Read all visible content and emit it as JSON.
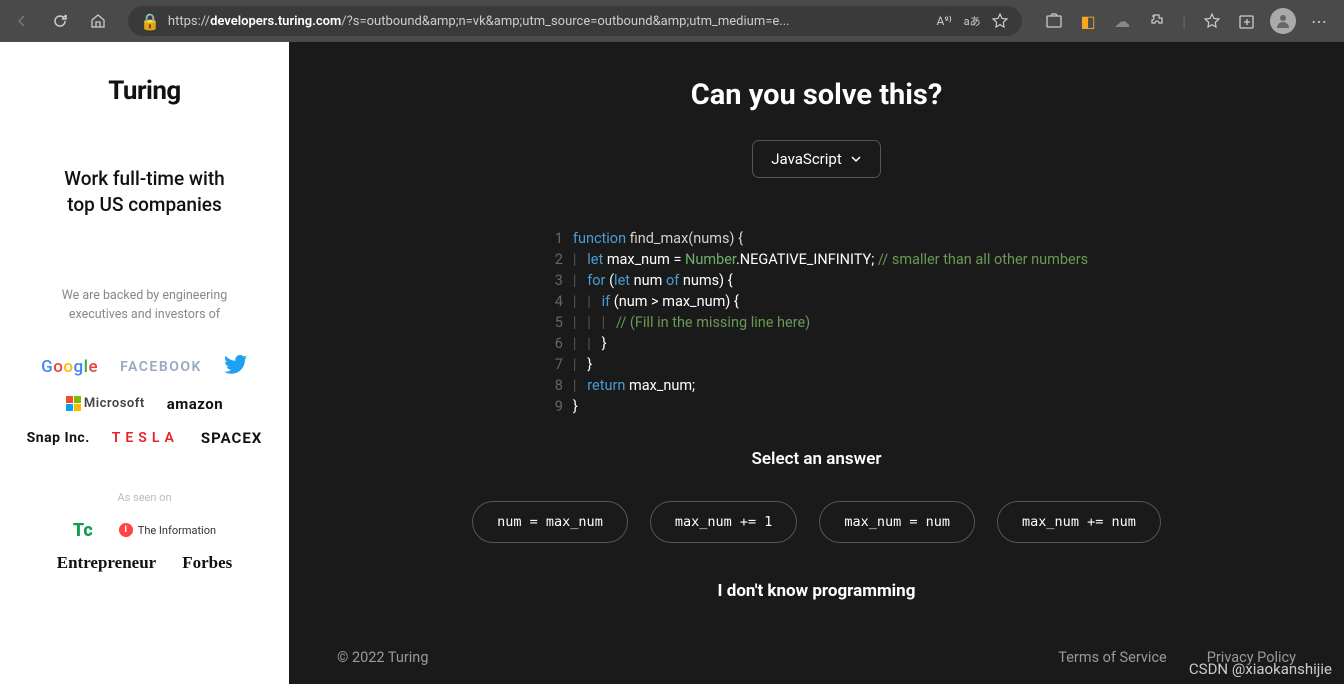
{
  "browser": {
    "url_prefix": "https://",
    "url_bold": "developers.turing.com",
    "url_rest": "/?s=outbound&amp;n=vk&amp;utm_source=outbound&amp;utm_medium=e...",
    "read_aloud": "A⁹⁾",
    "translate": "aあ"
  },
  "sidebar": {
    "logo": "Turing",
    "tagline_l1": "Work full-time with",
    "tagline_l2": "top US companies",
    "backed_l1": "We are backed by engineering",
    "backed_l2": "executives and investors of",
    "companies": {
      "google": "Google",
      "facebook": "FACEBOOK",
      "microsoft": "Microsoft",
      "amazon": "amazon",
      "snap": "Snap Inc.",
      "tesla": "TESLA",
      "spacex": "SPACEX"
    },
    "asseen": "As seen on",
    "press": {
      "tc": "Tc",
      "info": "The Information",
      "ent": "Entrepreneur",
      "forbes": "Forbes"
    }
  },
  "main": {
    "title": "Can you solve this?",
    "language": "JavaScript",
    "code_lines": [
      {
        "n": "1",
        "html": "<span class='kw'>function</span> <span class='fn'>find_max</span><span class='pn'>(nums)</span> <span class='pl'>{</span>"
      },
      {
        "n": "2",
        "html": "<span class='g'>|</span>   <span class='kw2'>let</span> max_num = <span class='nm'>Number</span>.NEGATIVE_INFINITY; <span class='cm'>// smaller than all other numbers</span>"
      },
      {
        "n": "3",
        "html": "<span class='g'>|</span>   <span class='kw'>for</span> (<span class='kw2'>let</span> num <span class='kw'>of</span> nums) {"
      },
      {
        "n": "4",
        "html": "<span class='g'>|</span>   <span class='g'>|</span>   <span class='kw'>if</span> (num &gt; max_num) {"
      },
      {
        "n": "5",
        "html": "<span class='g'>|</span>   <span class='g'>|</span>   <span class='g'>|</span>   <span class='cm'>// (Fill in the missing line here)</span>"
      },
      {
        "n": "6",
        "html": "<span class='g'>|</span>   <span class='g'>|</span>   }"
      },
      {
        "n": "7",
        "html": "<span class='g'>|</span>   }"
      },
      {
        "n": "8",
        "html": "<span class='g'>|</span>   <span class='kw'>return</span> max_num;"
      },
      {
        "n": "9",
        "html": "}"
      }
    ],
    "select_answer": "Select an answer",
    "answers": [
      "num = max_num",
      "max_num += 1",
      "max_num = num",
      "max_num += num"
    ],
    "dunno": "I don't know programming"
  },
  "footer": {
    "copyright": "© 2022 Turing",
    "tos": "Terms of Service",
    "privacy": "Privacy Policy"
  },
  "watermark": "CSDN @xiaokanshijie"
}
